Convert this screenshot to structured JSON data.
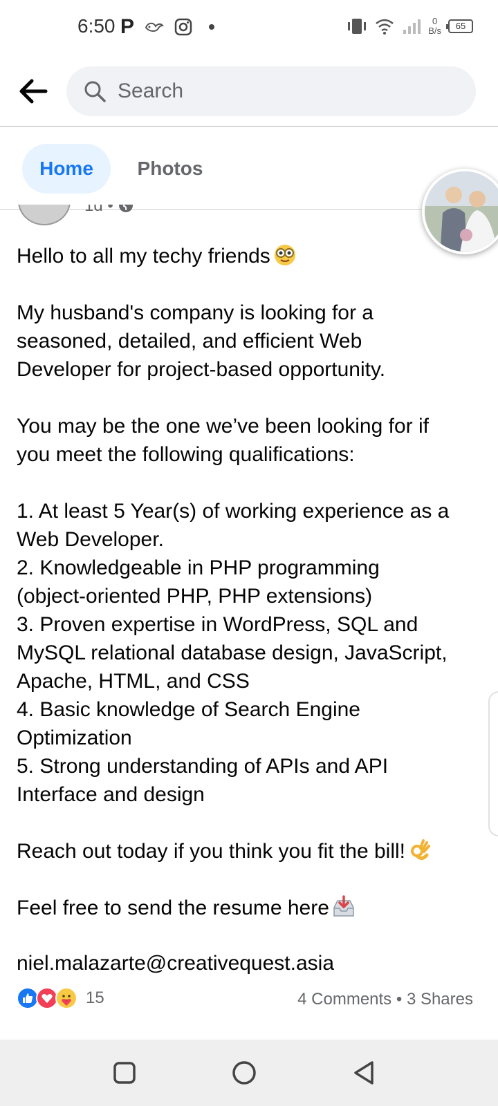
{
  "status_bar": {
    "time": "6:50",
    "app_letter": "P",
    "speed_value": "0",
    "speed_unit": "B/s",
    "battery": "65"
  },
  "topbar": {
    "back_icon": "arrow-left-icon",
    "search_placeholder": "Search"
  },
  "tabs": [
    {
      "label": "Home",
      "active": true
    },
    {
      "label": "Photos",
      "active": false
    }
  ],
  "post": {
    "time": "1d",
    "privacy_icon": "globe-icon",
    "paragraphs": [
      [
        "Hello to all my techy friends"
      ],
      [
        "My husband's company is looking for a",
        "seasoned, detailed, and efficient Web",
        "Developer for project-based opportunity."
      ],
      [
        "You may be the one we’ve been looking for if",
        "you meet the following qualifications:"
      ],
      [
        "1. At least 5 Year(s) of working experience as a",
        "Web Developer.",
        "2. Knowledgeable in PHP programming",
        "(object-oriented PHP, PHP extensions)",
        "3. Proven expertise in WordPress, SQL and",
        "MySQL relational database design, JavaScript,",
        "Apache, HTML, and CSS",
        "4. Basic knowledge of Search Engine",
        "Optimization",
        "5. Strong understanding of APIs and API",
        "Interface and design"
      ],
      [
        "Reach out today if you think you fit the bill!"
      ],
      [
        "Feel free to send the resume here"
      ],
      [
        "niel.malazarte@creativequest.asia"
      ]
    ],
    "emojis": {
      "greeting": "nerd-face-emoji",
      "reach_out": "ok-hand-emoji",
      "resume": "inbox-tray-emoji"
    },
    "reactions": {
      "icons": [
        "like-icon",
        "love-icon",
        "care-icon"
      ],
      "count": "15"
    },
    "comments": "4 Comments",
    "separator": "•",
    "shares": "3 Shares"
  },
  "navbar": {
    "buttons": [
      "recents-square-icon",
      "home-circle-icon",
      "back-triangle-icon"
    ]
  },
  "colors": {
    "accent": "#1877f2",
    "tab_active_bg": "#e7f3ff",
    "muted": "#65676b",
    "search_bg": "#f0f2f5",
    "navbar_bg": "#efefef"
  }
}
